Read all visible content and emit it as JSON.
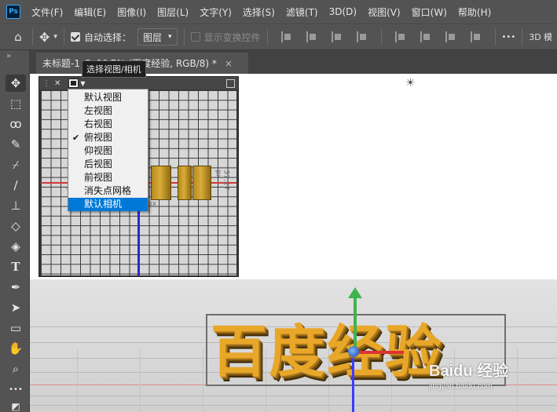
{
  "app": {
    "logo": "Ps"
  },
  "menubar": {
    "items": [
      "文件(F)",
      "编辑(E)",
      "图像(I)",
      "图层(L)",
      "文字(Y)",
      "选择(S)",
      "滤镜(T)",
      "3D(D)",
      "视图(V)",
      "窗口(W)",
      "帮助(H)"
    ]
  },
  "options": {
    "home_icon": "home-icon",
    "move_icon": "move-icon",
    "auto_select_label": "自动选择：",
    "auto_select_checked": true,
    "layer_select_value": "图层",
    "show_transform_label": "显示变换控件",
    "show_transform_checked": false,
    "more_label": "•••",
    "mode_3d_label": "3D 模"
  },
  "toolbar": {
    "tools": [
      "move-tool",
      "marquee-tool",
      "lasso-tool",
      "quick-select-tool",
      "eyedropper-tool",
      "brush-tool",
      "stamp-tool",
      "eraser-tool",
      "paint-bucket-tool",
      "type-tool",
      "pen-tool",
      "path-select-tool",
      "rectangle-tool",
      "hand-tool",
      "zoom-tool",
      "more-tools"
    ]
  },
  "document": {
    "tab_title": "未标题-1 @ 66.7% (百度经验, RGB/8) *",
    "close_glyph": "×"
  },
  "tooltip": {
    "text": "选择视图/相机"
  },
  "view_panel": {
    "dim_left": "37.27 px",
    "dim_right": "37.27 px",
    "dim_bottom": "px"
  },
  "view_menu": {
    "items": [
      {
        "label": "默认视图",
        "checked": false,
        "highlight": false
      },
      {
        "label": "左视图",
        "checked": false,
        "highlight": false
      },
      {
        "label": "右视图",
        "checked": false,
        "highlight": false
      },
      {
        "label": "俯视图",
        "checked": true,
        "highlight": false
      },
      {
        "label": "仰视图",
        "checked": false,
        "highlight": false
      },
      {
        "label": "后视图",
        "checked": false,
        "highlight": false
      },
      {
        "label": "前视图",
        "checked": false,
        "highlight": false
      },
      {
        "label": "消失点网格",
        "checked": false,
        "highlight": false
      },
      {
        "label": "默认相机",
        "checked": false,
        "highlight": true
      }
    ],
    "check_glyph": "✔"
  },
  "canvas": {
    "text_3d": "百度经验",
    "text_color": "#e8a729",
    "light_icon": "sun-icon"
  },
  "watermark": {
    "logo": "Baidu 经验",
    "url": "jingyan.baidu.com"
  }
}
